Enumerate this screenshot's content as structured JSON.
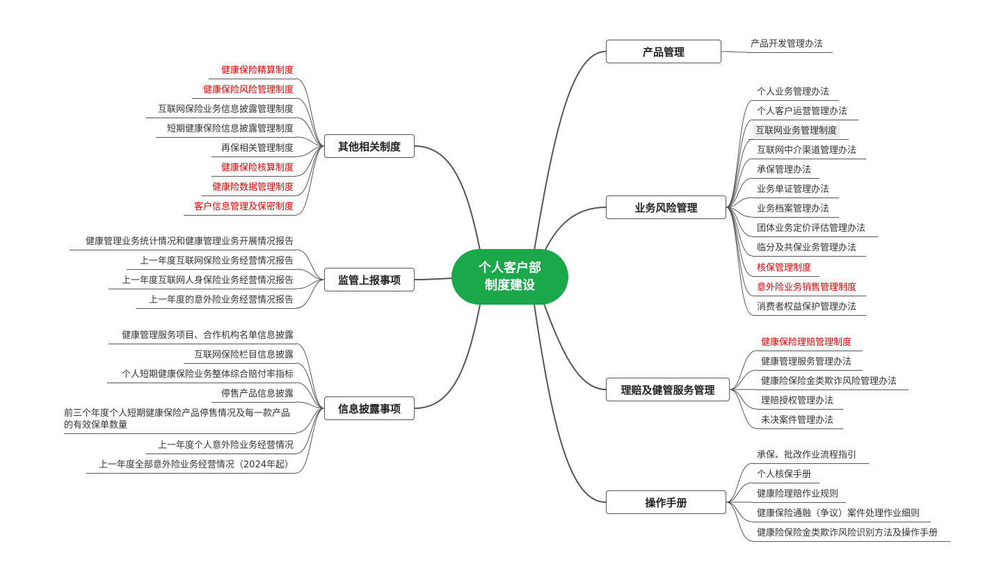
{
  "center": {
    "line1": "个人客户部",
    "line2": "制度建设"
  },
  "colors": {
    "center": "#1aa84a",
    "emphasis": "#e00000",
    "line": "#555555"
  },
  "branches": {
    "product": {
      "label": "产品管理",
      "items": [
        "产品开发管理办法"
      ]
    },
    "business": {
      "label": "业务风险管理",
      "items": [
        "个人业务管理办法",
        "个人客户运营管理办法",
        "互联网业务管理制度",
        "互联网中介渠道管理办法",
        "承保管理办法",
        "业务单证管理办法",
        "业务档案管理办法",
        "团体业务定价评估管理办法",
        "临分及共保业务管理办法",
        "核保管理制度",
        "意外险业务销售管理制度",
        "消费者权益保护管理办法"
      ]
    },
    "claims": {
      "label": "理赔及健管服务管理",
      "items": [
        "健康保险理赔管理制度",
        "健康管理服务管理办法",
        "健康险保险金类欺诈风险管理办法",
        "理赔授权管理办法",
        "未决案件管理办法"
      ]
    },
    "manual": {
      "label": "操作手册",
      "items": [
        "承保、批改作业流程指引",
        "个人核保手册",
        "健康险理赔作业规则",
        "健康保险通融（争议）案件处理作业细则",
        "健康险保险金类欺诈风险识别方法及操作手册"
      ]
    },
    "other": {
      "label": "其他相关制度",
      "items": [
        "健康保险精算制度",
        "健康保险风险管理制度",
        "互联网保险业务信息披露管理制度",
        "短期健康保险信息披露管理制度",
        "再保相关管理制度",
        "健康保险核算制度",
        "健康险数据管理制度",
        "客户信息管理及保密制度"
      ]
    },
    "regulatory": {
      "label": "监管上报事项",
      "items": [
        "健康管理业务统计情况和健康管理业务开展情况报告",
        "上一年度互联网保险业务经营情况报告",
        "上一年度互联网人身保险业务经营情况报告",
        "上一年度的意外险业务经营情况报告"
      ]
    },
    "disclosure": {
      "label": "信息披露事项",
      "items": [
        "健康管理服务项目、合作机构名单信息披露",
        "互联网保险栏目信息披露",
        "个人短期健康保险业务整体综合赔付率指标",
        "停售产品信息披露",
        "前三个年度个人短期健康保险产品停售情况及每一款产品的有效保单数量",
        "上一年度个人意外险业务经营情况",
        "上一年度全部意外险业务经营情况（2024年起）"
      ]
    }
  }
}
